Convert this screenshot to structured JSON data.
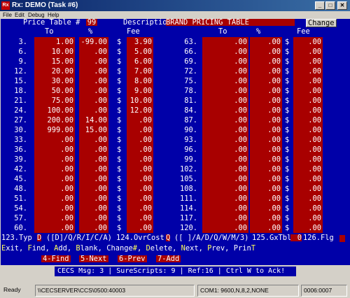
{
  "window": {
    "title": "Rx: DEMO  (Task #6)",
    "icon_label": "Rx",
    "minimize_glyph": "_",
    "maximize_glyph": "□",
    "close_glyph": "✕"
  },
  "menu": [
    {
      "label": "File"
    },
    {
      "label": "Edit"
    },
    {
      "label": "Debug"
    },
    {
      "label": "Help"
    }
  ],
  "header": {
    "price_table_label": "Price Table #",
    "price_table_value": "99",
    "description_label": "Description",
    "description_value": "BRAND PRICING TABLE",
    "change_button": "Change"
  },
  "columns": {
    "to": "To",
    "pct": "%",
    "fee": "Fee"
  },
  "currency": "$",
  "table_left": [
    {
      "row": "3.",
      "to": "1.00",
      "pct": "-99.00",
      "fee": "3.90"
    },
    {
      "row": "6.",
      "to": "10.00",
      "pct": ".00",
      "fee": "5.00"
    },
    {
      "row": "9.",
      "to": "15.00",
      "pct": ".00",
      "fee": "6.00"
    },
    {
      "row": "12.",
      "to": "20.00",
      "pct": ".00",
      "fee": "7.00"
    },
    {
      "row": "15.",
      "to": "30.00",
      "pct": ".00",
      "fee": "8.00"
    },
    {
      "row": "18.",
      "to": "50.00",
      "pct": ".00",
      "fee": "9.00"
    },
    {
      "row": "21.",
      "to": "75.00",
      "pct": ".00",
      "fee": "10.00"
    },
    {
      "row": "24.",
      "to": "100.00",
      "pct": ".00",
      "fee": "12.00"
    },
    {
      "row": "27.",
      "to": "200.00",
      "pct": "14.00",
      "fee": ".00"
    },
    {
      "row": "30.",
      "to": "999.00",
      "pct": "15.00",
      "fee": ".00"
    },
    {
      "row": "33.",
      "to": ".00",
      "pct": ".00",
      "fee": ".00"
    },
    {
      "row": "36.",
      "to": ".00",
      "pct": ".00",
      "fee": ".00"
    },
    {
      "row": "39.",
      "to": ".00",
      "pct": ".00",
      "fee": ".00"
    },
    {
      "row": "42.",
      "to": ".00",
      "pct": ".00",
      "fee": ".00"
    },
    {
      "row": "45.",
      "to": ".00",
      "pct": ".00",
      "fee": ".00"
    },
    {
      "row": "48.",
      "to": ".00",
      "pct": ".00",
      "fee": ".00"
    },
    {
      "row": "51.",
      "to": ".00",
      "pct": ".00",
      "fee": ".00"
    },
    {
      "row": "54.",
      "to": ".00",
      "pct": ".00",
      "fee": ".00"
    },
    {
      "row": "57.",
      "to": ".00",
      "pct": ".00",
      "fee": ".00"
    },
    {
      "row": "60.",
      "to": ".00",
      "pct": ".00",
      "fee": ".00"
    }
  ],
  "table_right": [
    {
      "row": "63.",
      "to": ".00",
      "pct": ".00",
      "fee": ".00"
    },
    {
      "row": "66.",
      "to": ".00",
      "pct": ".00",
      "fee": ".00"
    },
    {
      "row": "69.",
      "to": ".00",
      "pct": ".00",
      "fee": ".00"
    },
    {
      "row": "72.",
      "to": ".00",
      "pct": ".00",
      "fee": ".00"
    },
    {
      "row": "75.",
      "to": ".00",
      "pct": ".00",
      "fee": ".00"
    },
    {
      "row": "78.",
      "to": ".00",
      "pct": ".00",
      "fee": ".00"
    },
    {
      "row": "81.",
      "to": ".00",
      "pct": ".00",
      "fee": ".00"
    },
    {
      "row": "84.",
      "to": ".00",
      "pct": ".00",
      "fee": ".00"
    },
    {
      "row": "87.",
      "to": ".00",
      "pct": ".00",
      "fee": ".00"
    },
    {
      "row": "90.",
      "to": ".00",
      "pct": ".00",
      "fee": ".00"
    },
    {
      "row": "93.",
      "to": ".00",
      "pct": ".00",
      "fee": ".00"
    },
    {
      "row": "96.",
      "to": ".00",
      "pct": ".00",
      "fee": ".00"
    },
    {
      "row": "99.",
      "to": ".00",
      "pct": ".00",
      "fee": ".00"
    },
    {
      "row": "102.",
      "to": ".00",
      "pct": ".00",
      "fee": ".00"
    },
    {
      "row": "105.",
      "to": ".00",
      "pct": ".00",
      "fee": ".00"
    },
    {
      "row": "108.",
      "to": ".00",
      "pct": ".00",
      "fee": ".00"
    },
    {
      "row": "111.",
      "to": ".00",
      "pct": ".00",
      "fee": ".00"
    },
    {
      "row": "114.",
      "to": ".00",
      "pct": ".00",
      "fee": ".00"
    },
    {
      "row": "117.",
      "to": ".00",
      "pct": ".00",
      "fee": ".00"
    },
    {
      "row": "120.",
      "to": ".00",
      "pct": ".00",
      "fee": ".00"
    }
  ],
  "options_line": {
    "typ_label": "123.Typ",
    "typ_value": "D",
    "typ_choices": "([D]/Q/R/I/C/A)",
    "ovrcost_label": "124.OvrCost",
    "ovrcost_value": "Q",
    "ovrcost_choices": "([ ]/A/D/Q/W/M/3)",
    "gxtbl_label": "125.GxTbl",
    "gxtbl_value": "0",
    "flg_label": "126.Flg"
  },
  "commands": {
    "line1": "Exit, Find, Add, Blank, Change#, Delete, Next, Prev, PrinT",
    "fkeys": [
      "4-Find",
      "5-Next",
      "6-Prev",
      "7-Add"
    ]
  },
  "message_line": "CECS Msg: 3 | SureScripts: 9 | Ref:16 | Ctrl W to Ack!",
  "statusbar": {
    "state": "Ready",
    "server": "\\\\CECSERVER\\CCS\\0500:40003",
    "port": "COM1: 9600,N,8,2,NONE",
    "counter": "0006:0007"
  },
  "colors": {
    "console_bg": "#0000a8",
    "field_bg": "#a80000",
    "text": "#ffffff",
    "hotkey": "#ffff55"
  }
}
